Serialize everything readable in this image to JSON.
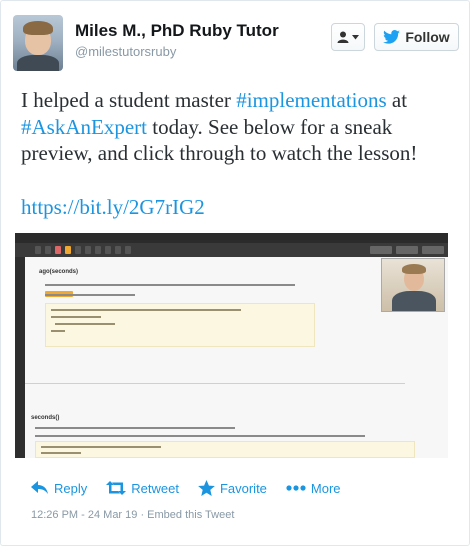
{
  "author": {
    "display_name": "Miles M., PhD Ruby Tutor",
    "handle": "@milestutorsruby",
    "avatar_icon": "profile-photo"
  },
  "buttons": {
    "user_menu_icon": "user-dropdown-icon",
    "follow_label": "Follow"
  },
  "tweet": {
    "part1": "I helped a student master ",
    "hashtag1": "#implementations",
    "part2": " at ",
    "hashtag2": "#AskAnExpert",
    "part3": " today. See below for a sneak preview, and click through to watch the lesson!",
    "link": "https://bit.ly/2G7rIG2"
  },
  "media": {
    "section1_title": "ago(seconds)",
    "section2_title": "seconds()"
  },
  "actions": {
    "reply": "Reply",
    "retweet": "Retweet",
    "favorite": "Favorite",
    "more": "More"
  },
  "meta": {
    "timestamp": "12:26 PM - 24 Mar 19",
    "separator": " · ",
    "embed": "Embed this Tweet"
  },
  "colors": {
    "link": "#1b95e0",
    "text": "#292f33",
    "muted": "#8899a6"
  }
}
